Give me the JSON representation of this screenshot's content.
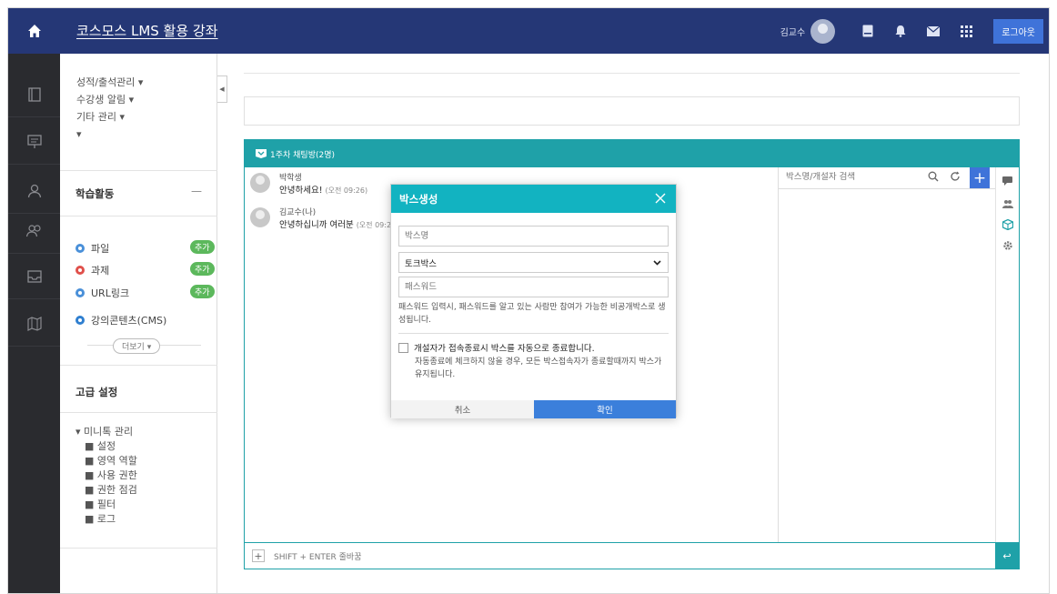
{
  "header": {
    "course_title": "코스모스 LMS 활용 강좌",
    "user_name": "김교수",
    "logout_label": "로그아웃",
    "icons": [
      "home-icon",
      "tablet-icon",
      "bell-icon",
      "mail-icon",
      "apps-grid-icon"
    ],
    "bg_color": "#253776"
  },
  "rail": {
    "icons": [
      "book-icon",
      "presentation-icon",
      "user-icon",
      "users-icon",
      "inbox-icon",
      "map-icon"
    ]
  },
  "sidebar": {
    "manage_links": [
      "성적/출석관리 ▾",
      "수강생 알림 ▾",
      "기타 관리 ▾",
      "▾"
    ],
    "activity_title": "학습활동",
    "activity_toggle": "—",
    "activities": [
      {
        "label": "파일",
        "color": "#4a90d9",
        "badge": "추가"
      },
      {
        "label": "과제",
        "color": "#e0504b",
        "badge": "추가"
      },
      {
        "label": "URL링크",
        "color": "#4a90d9",
        "badge": "추가"
      },
      {
        "label": "강의콘텐츠(CMS)",
        "color": "#2f7fd0",
        "badge": ""
      }
    ],
    "more_label": "더보기 ▾",
    "advanced_title": "고급 설정",
    "tree_root": "▾ 미니톡 관리",
    "tree_items": [
      "■ 설정",
      "■ 영역 역할",
      "■ 사용 권한",
      "■ 권한 점검",
      "■ 필터",
      "■ 로그"
    ]
  },
  "chat": {
    "header_label": "1주차 채팅방(2명)",
    "accent_color": "#1fa1a8",
    "messages": [
      {
        "name": "박학생",
        "text": "안녕하세요!",
        "time": "(오전 09:26)"
      },
      {
        "name": "김교수(나)",
        "text": "안녕하십니까 여러분",
        "time": "(오전 09:26)"
      }
    ],
    "user_search_placeholder": "박스명/개설자 검색",
    "input_placeholder": "SHIFT + ENTER 줄바꿈",
    "enter_label": "↩"
  },
  "modal": {
    "title": "박스생성",
    "box_name_placeholder": "박스명",
    "box_type_value": "토크박스",
    "password_placeholder": "패스워드",
    "password_help": "패스워드 입력시, 패스워드를 알고 있는 사람만 참여가 가능한 비공개박스로 생성됩니다.",
    "auto_close_label": "개설자가 접속종료시 박스를 자동으로 종료합니다.",
    "auto_close_desc": "자동종료에 체크하지 않을 경우, 모든 박스접속자가 종료할때까지 박스가 유지됩니다.",
    "auto_close_checked": false,
    "cancel_label": "취소",
    "ok_label": "확인",
    "header_color": "#12b3c1",
    "ok_color": "#3b7fdb"
  }
}
